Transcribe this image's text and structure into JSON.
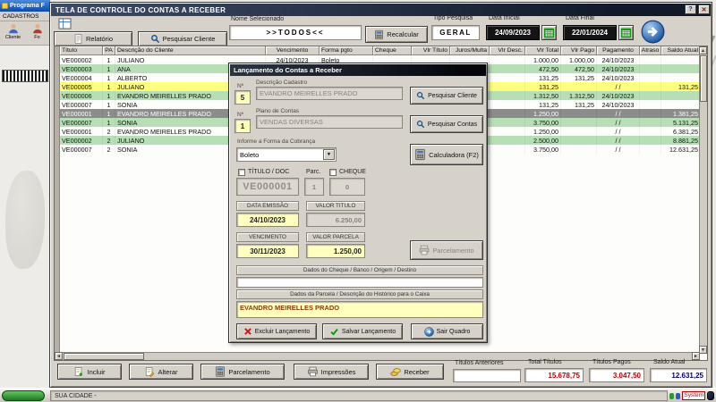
{
  "desktop": {
    "background_app": {
      "title": "Programa F",
      "menu_label": "CADASTROS",
      "toolbar_items": [
        {
          "label": "Cliente"
        },
        {
          "label": "Fo"
        }
      ]
    },
    "taskbar": {
      "tray_badge": "System"
    }
  },
  "window": {
    "title": "TELA DE CONTROLE DO CONTAS A RECEBER",
    "titlebar_buttons": {
      "help": "?",
      "close": "✕"
    },
    "toolbar": {
      "report_label": "Relatório",
      "search_client_label": "Pesquisar Cliente",
      "selected_name_label": "Nome Selecionado",
      "selected_name_value": ">>TODOS<<",
      "recalc_label": "Recalcular",
      "search_type_label": "Tipo Pesquisa",
      "search_type_value": "GERAL",
      "date_start_label": "Data Inicial",
      "date_start_value": "24/09/2023",
      "date_end_label": "Data Final",
      "date_end_value": "22/01/2024"
    },
    "table": {
      "columns": [
        "Título",
        "PA",
        "Descrição do Cliente",
        "Vencimento",
        "Forma pgto",
        "Cheque",
        "Vlr Título",
        "Juros/Multa",
        "Vlr Desc.",
        "Vlr Total",
        "Vlr Pago",
        "Pagamento",
        "Atraso",
        "Saldo Atual"
      ],
      "rows": [
        {
          "titulo": "VE000002",
          "pa": "1",
          "cliente": "JULIANO",
          "vencimento": "24/10/2023",
          "forma": "Boleto",
          "cheque": "",
          "vlr_titulo": "",
          "juros": "",
          "desc": "",
          "total": "1.000,00",
          "pago": "1.000,00",
          "pagamento": "24/10/2023",
          "atraso": "",
          "saldo": "",
          "state": "white"
        },
        {
          "titulo": "VE000003",
          "pa": "1",
          "cliente": "ANA",
          "vencimento": "",
          "forma": "",
          "cheque": "",
          "vlr_titulo": "",
          "juros": "",
          "desc": "",
          "total": "472,50",
          "pago": "472,50",
          "pagamento": "24/10/2023",
          "atraso": "",
          "saldo": "",
          "state": "green"
        },
        {
          "titulo": "VE000004",
          "pa": "1",
          "cliente": "ALBERTO",
          "vencimento": "",
          "forma": "",
          "cheque": "",
          "vlr_titulo": "",
          "juros": "",
          "desc": "",
          "total": "131,25",
          "pago": "131,25",
          "pagamento": "24/10/2023",
          "atraso": "",
          "saldo": "",
          "state": "white"
        },
        {
          "titulo": "VE000005",
          "pa": "1",
          "cliente": "JULIANO",
          "vencimento": "",
          "forma": "",
          "cheque": "",
          "vlr_titulo": "",
          "juros": "",
          "desc": "",
          "total": "131,25",
          "pago": "",
          "pagamento": "/ /",
          "atraso": "",
          "saldo": "131,25",
          "state": "yellow"
        },
        {
          "titulo": "VE000006",
          "pa": "1",
          "cliente": "EVANDRO MEIRELLES PRADO",
          "vencimento": "",
          "forma": "",
          "cheque": "",
          "vlr_titulo": "",
          "juros": "",
          "desc": "",
          "total": "1.312,50",
          "pago": "1.312,50",
          "pagamento": "24/10/2023",
          "atraso": "",
          "saldo": "",
          "state": "green"
        },
        {
          "titulo": "VE000007",
          "pa": "1",
          "cliente": "SONIA",
          "vencimento": "",
          "forma": "",
          "cheque": "",
          "vlr_titulo": "",
          "juros": "",
          "desc": "",
          "total": "131,25",
          "pago": "131,25",
          "pagamento": "24/10/2023",
          "atraso": "",
          "saldo": "",
          "state": "white"
        },
        {
          "titulo": "VE000001",
          "pa": "1",
          "cliente": "EVANDRO MEIRELLES PRADO",
          "vencimento": "",
          "forma": "",
          "cheque": "",
          "vlr_titulo": "",
          "juros": "",
          "desc": "",
          "total": "1.250,00",
          "pago": "",
          "pagamento": "/ /",
          "atraso": "",
          "saldo": "1.381,25",
          "state": "selected"
        },
        {
          "titulo": "VE000007",
          "pa": "1",
          "cliente": "SONIA",
          "vencimento": "",
          "forma": "",
          "cheque": "",
          "vlr_titulo": "",
          "juros": "",
          "desc": "",
          "total": "3.750,00",
          "pago": "",
          "pagamento": "/ /",
          "atraso": "",
          "saldo": "5.131,25",
          "state": "green"
        },
        {
          "titulo": "VE000001",
          "pa": "2",
          "cliente": "EVANDRO MEIRELLES PRADO",
          "vencimento": "",
          "forma": "",
          "cheque": "",
          "vlr_titulo": "",
          "juros": "",
          "desc": "",
          "total": "1.250,00",
          "pago": "",
          "pagamento": "/ /",
          "atraso": "",
          "saldo": "6.381,25",
          "state": "white"
        },
        {
          "titulo": "VE000002",
          "pa": "2",
          "cliente": "JULIANO",
          "vencimento": "",
          "forma": "",
          "cheque": "",
          "vlr_titulo": "",
          "juros": "",
          "desc": "",
          "total": "2.500,00",
          "pago": "",
          "pagamento": "/ /",
          "atraso": "",
          "saldo": "8.881,25",
          "state": "green"
        },
        {
          "titulo": "VE000007",
          "pa": "2",
          "cliente": "SONIA",
          "vencimento": "",
          "forma": "",
          "cheque": "",
          "vlr_titulo": "",
          "juros": "",
          "desc": "",
          "total": "3.750,00",
          "pago": "",
          "pagamento": "/ /",
          "atraso": "",
          "saldo": "12.631,25",
          "state": "white"
        }
      ]
    },
    "footer": {
      "include_label": "Incluir",
      "edit_label": "Alterar",
      "installments_label": "Parcelamento",
      "prints_label": "Impressões",
      "receive_label": "Receber",
      "previous_titles_label": "Títulos Anteriores",
      "total_titles_label": "Total Títulos",
      "total_titles_value": "15.678,75",
      "paid_titles_label": "Títulos Pagos",
      "paid_titles_value": "3.047,50",
      "balance_label": "Saldo Atual",
      "balance_value": "12.631,25"
    },
    "statusbar_text": "SUA CIDADE -"
  },
  "modal": {
    "title": "Lançamento do Contas a Receber",
    "client_number_label": "Nº",
    "client_number_value": "5",
    "client_desc_label": "Descrição Cadastro",
    "client_desc_value": "EVANDRO MEIRELLES PRADO",
    "search_client_label": "Pesquisar Cliente",
    "account_number_label": "Nº",
    "account_number_value": "1",
    "account_plan_label": "Plano de Contas",
    "account_plan_value": "VENDAS DIVERSAS",
    "search_accounts_label": "Pesquisar Contas",
    "billing_form_label": "Informe a Forma da Cobrança",
    "billing_form_value": "Boleto",
    "calculator_label": "Calculadora (F2)",
    "titulo_doc_checkbox_label": "TÍTULO / DOC",
    "parc_label": "Parc.",
    "cheque_checkbox_label": "CHEQUE",
    "titulo_doc_value": "VE000001",
    "parc_value": "1",
    "cheque_value": "0",
    "emission_date_label": "DATA EMISSÃO",
    "emission_date_value": "24/10/2023",
    "title_value_label": "VALOR TITULO",
    "title_value_value": "6.250,00",
    "due_date_label": "VENCIMENTO",
    "due_date_value": "30/11/2023",
    "installment_value_label": "VALOR PARCELA",
    "installment_value_value": "1.250,00",
    "installments_label": "Parcelamento",
    "cheque_data_label": "Dados do Cheque / Banco / Origem / Destino",
    "cheque_data_value": "",
    "history_label": "Dados da Parcela / Descrição do Histórico para o Caixa",
    "history_value": "EVANDRO MEIRELLES PRADO",
    "delete_label": "Excluir Lançamento",
    "save_label": "Salvar Lançamento",
    "exit_label": "Sair Quadro"
  },
  "colors": {
    "total_red": "#c00000",
    "balance_navy": "#000080",
    "row_green": "#b6dfb6",
    "row_yellow": "#ffff7c",
    "row_selected": "#8c8c8c",
    "calendar_green": "#0f9b0f"
  }
}
